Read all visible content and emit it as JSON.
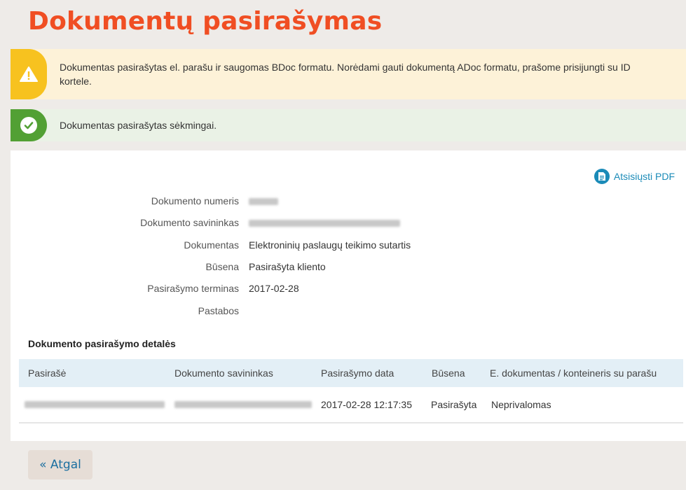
{
  "title": "Dokumentų pasirašymas",
  "alerts": {
    "warning": "Dokumentas pasirašytas el. parašu ir saugomas BDoc formatu. Norėdami gauti dokumentą ADoc formatu, prašome prisijungti su ID kortele.",
    "success": "Dokumentas pasirašytas sėkmingai."
  },
  "pdf_link": "Atsisiųsti PDF",
  "details": {
    "number_label": "Dokumento numeris",
    "owner_label": "Dokumento savininkas",
    "document_label": "Dokumentas",
    "document_value": "Elektroninių paslaugų teikimo sutartis",
    "status_label": "Būsena",
    "status_value": "Pasirašyta kliento",
    "deadline_label": "Pasirašymo terminas",
    "deadline_value": "2017-02-28",
    "notes_label": "Pastabos"
  },
  "section_title": "Dokumento pasirašymo detalės",
  "table": {
    "headers": [
      "Pasirašė",
      "Dokumento savininkas",
      "Pasirašymo data",
      "Būsena",
      "E. dokumentas / konteineris su parašu"
    ],
    "row": {
      "date": "2017-02-28 12:17:35",
      "status": "Pasirašyta",
      "container": "Neprivalomas"
    }
  },
  "back_button": "« Atgal",
  "colors": {
    "accent": "#f04e23",
    "warning": "#f7c21f",
    "success": "#52a034",
    "link": "#1b8bb8"
  },
  "icons": [
    "warning-icon",
    "check-icon",
    "pdf-icon"
  ]
}
